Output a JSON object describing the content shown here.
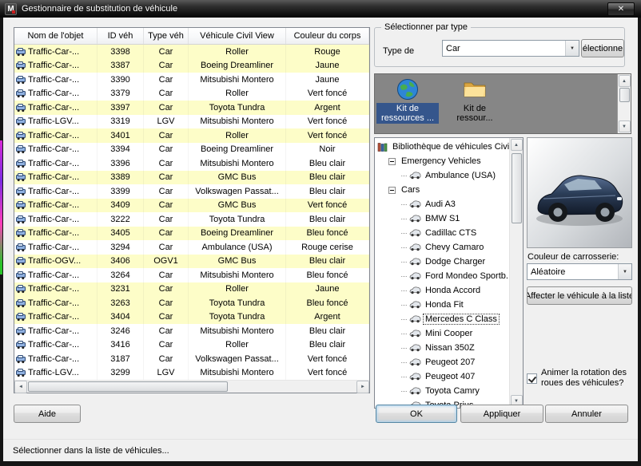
{
  "window": {
    "title": "Gestionnaire de substitution de véhicule",
    "close": "✕",
    "icon_letter": "M"
  },
  "vehicle_table": {
    "columns": [
      "Nom de l'objet",
      "ID véh",
      "Type véh",
      "Véhicule Civil View",
      "Couleur du corps"
    ],
    "rows": [
      {
        "name": "Traffic-Car-...",
        "id": "3398",
        "type": "Car",
        "model": "Roller",
        "color": "Rouge",
        "highlight": true
      },
      {
        "name": "Traffic-Car-...",
        "id": "3387",
        "type": "Car",
        "model": "Boeing Dreamliner",
        "color": "Jaune",
        "highlight": true
      },
      {
        "name": "Traffic-Car-...",
        "id": "3390",
        "type": "Car",
        "model": "Mitsubishi Montero",
        "color": "Jaune",
        "highlight": false
      },
      {
        "name": "Traffic-Car-...",
        "id": "3379",
        "type": "Car",
        "model": "Roller",
        "color": "Vert foncé",
        "highlight": false
      },
      {
        "name": "Traffic-Car-...",
        "id": "3397",
        "type": "Car",
        "model": "Toyota Tundra",
        "color": "Argent",
        "highlight": true
      },
      {
        "name": "Traffic-LGV...",
        "id": "3319",
        "type": "LGV",
        "model": "Mitsubishi Montero",
        "color": "Vert foncé",
        "highlight": false
      },
      {
        "name": "Traffic-Car-...",
        "id": "3401",
        "type": "Car",
        "model": "Roller",
        "color": "Vert foncé",
        "highlight": true
      },
      {
        "name": "Traffic-Car-...",
        "id": "3394",
        "type": "Car",
        "model": "Boeing Dreamliner",
        "color": "Noir",
        "highlight": false
      },
      {
        "name": "Traffic-Car-...",
        "id": "3396",
        "type": "Car",
        "model": "Mitsubishi Montero",
        "color": "Bleu clair",
        "highlight": false
      },
      {
        "name": "Traffic-Car-...",
        "id": "3389",
        "type": "Car",
        "model": "GMC Bus",
        "color": "Bleu clair",
        "highlight": true
      },
      {
        "name": "Traffic-Car-...",
        "id": "3399",
        "type": "Car",
        "model": "Volkswagen Passat...",
        "color": "Bleu clair",
        "highlight": false
      },
      {
        "name": "Traffic-Car-...",
        "id": "3409",
        "type": "Car",
        "model": "GMC Bus",
        "color": "Vert foncé",
        "highlight": true
      },
      {
        "name": "Traffic-Car-...",
        "id": "3222",
        "type": "Car",
        "model": "Toyota Tundra",
        "color": "Bleu clair",
        "highlight": false
      },
      {
        "name": "Traffic-Car-...",
        "id": "3405",
        "type": "Car",
        "model": "Boeing Dreamliner",
        "color": "Bleu foncé",
        "highlight": true
      },
      {
        "name": "Traffic-Car-...",
        "id": "3294",
        "type": "Car",
        "model": "Ambulance (USA)",
        "color": "Rouge cerise",
        "highlight": false
      },
      {
        "name": "Traffic-OGV...",
        "id": "3406",
        "type": "OGV1",
        "model": "GMC Bus",
        "color": "Bleu clair",
        "highlight": true
      },
      {
        "name": "Traffic-Car-...",
        "id": "3264",
        "type": "Car",
        "model": "Mitsubishi Montero",
        "color": "Bleu foncé",
        "highlight": false
      },
      {
        "name": "Traffic-Car-...",
        "id": "3231",
        "type": "Car",
        "model": "Roller",
        "color": "Jaune",
        "highlight": true
      },
      {
        "name": "Traffic-Car-...",
        "id": "3263",
        "type": "Car",
        "model": "Toyota Tundra",
        "color": "Bleu foncé",
        "highlight": true
      },
      {
        "name": "Traffic-Car-...",
        "id": "3404",
        "type": "Car",
        "model": "Toyota Tundra",
        "color": "Argent",
        "highlight": true
      },
      {
        "name": "Traffic-Car-...",
        "id": "3246",
        "type": "Car",
        "model": "Mitsubishi Montero",
        "color": "Bleu clair",
        "highlight": false
      },
      {
        "name": "Traffic-Car-...",
        "id": "3416",
        "type": "Car",
        "model": "Roller",
        "color": "Bleu clair",
        "highlight": false
      },
      {
        "name": "Traffic-Car-...",
        "id": "3187",
        "type": "Car",
        "model": "Volkswagen Passat...",
        "color": "Vert foncé",
        "highlight": false
      },
      {
        "name": "Traffic-LGV...",
        "id": "3299",
        "type": "LGV",
        "model": "Mitsubishi Montero",
        "color": "Vert foncé",
        "highlight": false
      }
    ]
  },
  "select_by_type": {
    "legend": "Sélectionner par type",
    "label": "Type de",
    "value": "Car",
    "button": "électionne"
  },
  "resource_kits": {
    "items": [
      {
        "label": "Kit de ressources ...",
        "icon": "globe-icon",
        "selected": true
      },
      {
        "label": "Kit de ressour...",
        "icon": "folder-icon",
        "selected": false
      }
    ]
  },
  "library_tree": {
    "root": "Bibliothèque de véhicules Civil View",
    "groups": [
      {
        "label": "Emergency Vehicles",
        "children": [
          "Ambulance (USA)"
        ]
      },
      {
        "label": "Cars",
        "children": [
          "Audi A3",
          "BMW S1",
          "Cadillac CTS",
          "Chevy Camaro",
          "Dodge Charger",
          "Ford Mondeo Sportb...",
          "Honda Accord",
          "Honda Fit",
          "Mercedes C Class",
          "Mini Cooper",
          "Nissan 350Z",
          "Peugeot 207",
          "Peugeot 407",
          "Toyota Camry",
          "Toyota Prius"
        ]
      }
    ],
    "selected": "Mercedes C Class"
  },
  "body_color": {
    "label": "Couleur de carrosserie:",
    "value": "Aléatoire"
  },
  "assign_button": "Affecter le véhicule à la liste",
  "animate_checkbox": {
    "label": "Animer la rotation des roues des véhicules?",
    "checked": true
  },
  "buttons": {
    "help": "Aide",
    "ok": "OK",
    "apply": "Appliquer",
    "cancel": "Annuler"
  },
  "status": "Sélectionner dans la liste de véhicules...",
  "colors": {
    "highlight_row": "#fdfdc8",
    "selection_blue": "#35568c",
    "panel_gray": "#868686",
    "car_body": "#2c3e59"
  }
}
